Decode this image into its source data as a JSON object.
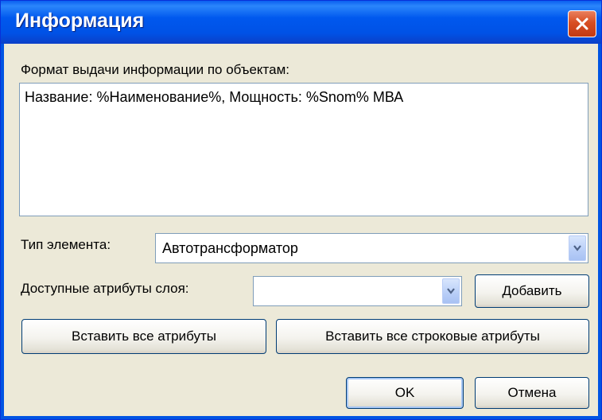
{
  "window": {
    "title": "Информация"
  },
  "format": {
    "label": "Формат выдачи информации по объектам:",
    "value": "Название: %Наименование%, Мощность: %Snom% МВА"
  },
  "element_type": {
    "label": "Тип элемента:",
    "value": "Автотрансформатор"
  },
  "layer_attributes": {
    "label": "Доступные атрибуты слоя:",
    "value": ""
  },
  "buttons": {
    "add_first_letter": "Д",
    "add_rest": "обавить",
    "insert_all": "Вставить все атрибуты",
    "insert_all_string": "Вставить все строковые атрибуты",
    "ok": "OK",
    "cancel": "Отмена"
  },
  "icons": {
    "close": "close-icon",
    "dropdown": "chevron-down-icon"
  },
  "colors": {
    "titlebar": "#0054e3",
    "close": "#d84e22",
    "dialog_bg": "#ece9d8"
  }
}
